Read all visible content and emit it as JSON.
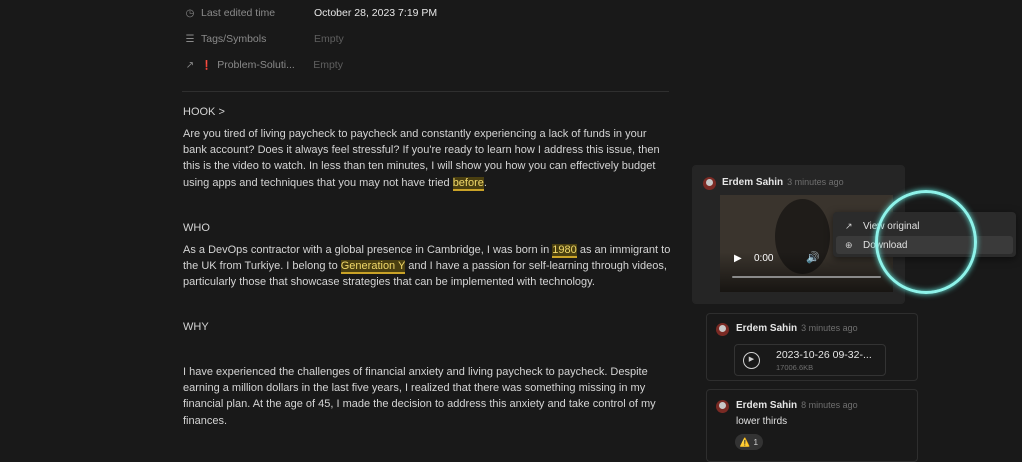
{
  "properties": [
    {
      "icon": "clock-icon",
      "glyph": "◷",
      "name": "Last edited time",
      "value": "October 28, 2023 7:19 PM",
      "empty": false
    },
    {
      "icon": "list-icon",
      "glyph": "☰",
      "name": "Tags/Symbols",
      "value": "Empty",
      "empty": true
    },
    {
      "icon": "arrow-up-right-icon",
      "glyph": "↗",
      "name": "Problem-Soluti...",
      "value": "Empty",
      "empty": true
    }
  ],
  "document": {
    "hook_heading": "HOOK >",
    "hook_text": "Are you tired of living paycheck to paycheck and constantly experiencing a lack of funds in your bank account? Does it always feel stressful? If you're ready to learn how I address this issue, then this is the video to watch. In less than ten minutes, I will show you how you can effectively budget using apps and techniques that you may not have tried ",
    "hook_highlight": "before",
    "hook_end": ".",
    "who_heading": "WHO",
    "who_text_1": "As a DevOps contractor with a global presence in Cambridge, I was born in ",
    "who_highlight_1": "1980",
    "who_text_2": " as an immigrant to the UK from Turkiye. I belong to ",
    "who_highlight_2": "Generation Y",
    "who_text_3": " and I have a passion for self-learning through videos, particularly those that showcase strategies that can be implemented with technology.",
    "why_heading": "WHY",
    "why_text": "I have experienced the challenges of financial anxiety and living paycheck to paycheck. Despite earning a million dollars in the last five years, I realized that there was something missing in my financial plan. At the age of 45, I made the decision to address this anxiety and take control of my finances."
  },
  "comments": [
    {
      "author": "Erdem Sahin",
      "time": "3 minutes ago",
      "video": {
        "current_time": "0:00"
      }
    },
    {
      "author": "Erdem Sahin",
      "time": "3 minutes ago",
      "file": {
        "name": "2023-10-26 09-32-...",
        "size": "17006.6KB"
      }
    },
    {
      "author": "Erdem Sahin",
      "time": "8 minutes ago",
      "text": "lower thirds",
      "reaction": {
        "emoji": "⚠️",
        "count": "1"
      }
    }
  ],
  "context_menu": {
    "items": [
      {
        "label": "View original",
        "icon": "arrow-up-right-icon",
        "selected": false
      },
      {
        "label": "Download",
        "icon": "download-icon",
        "selected": true
      }
    ]
  },
  "colors": {
    "background": "#191919",
    "highlight_ring": "#8ef3ea",
    "text_highlight": "#f0d86a"
  }
}
